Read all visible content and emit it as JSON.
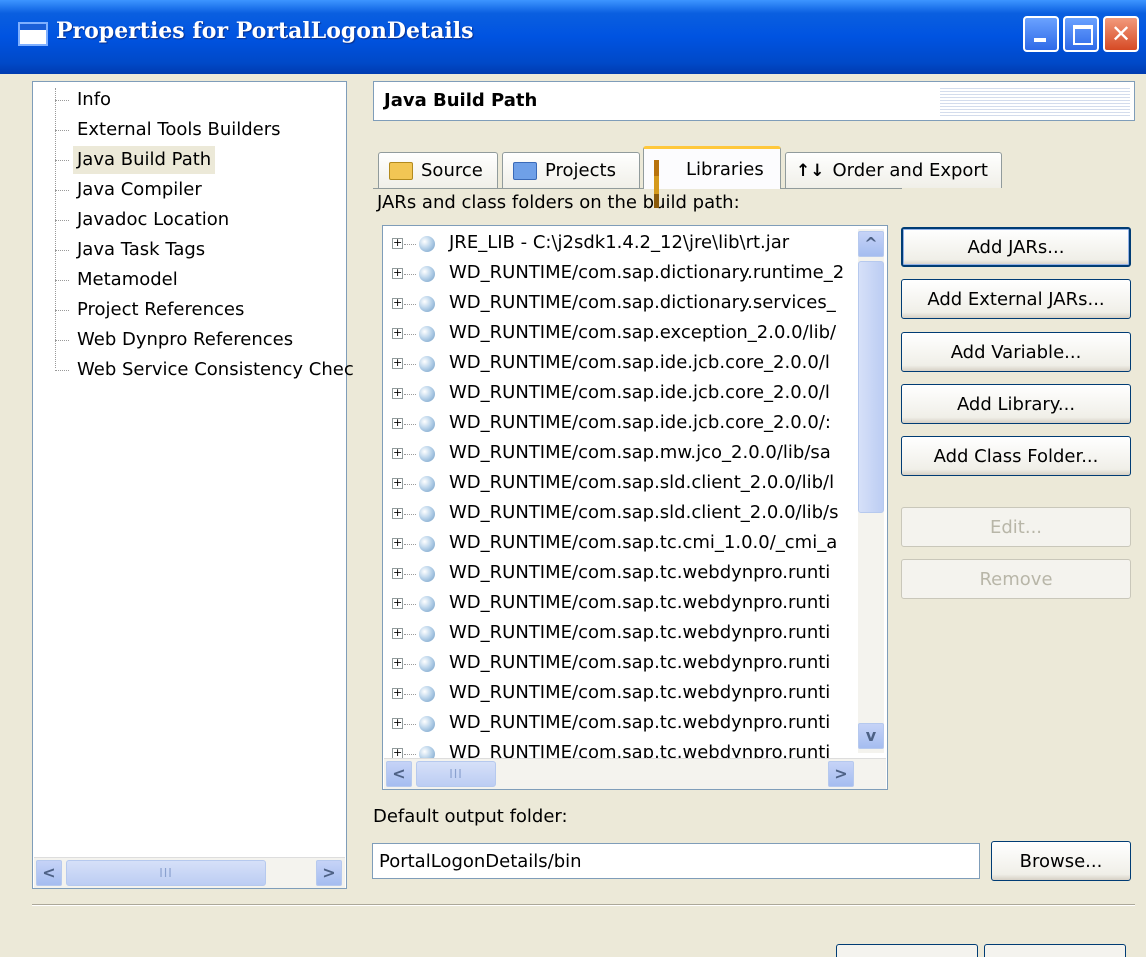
{
  "window": {
    "title": "Properties for PortalLogonDetails",
    "controls": [
      "minimize-icon",
      "maximize-icon",
      "close-icon"
    ],
    "close_glyph": "✕"
  },
  "tree": {
    "items": [
      {
        "label": "Info"
      },
      {
        "label": "External Tools Builders"
      },
      {
        "label": "Java Build Path",
        "selected": true
      },
      {
        "label": "Java Compiler"
      },
      {
        "label": "Javadoc Location"
      },
      {
        "label": "Java Task Tags"
      },
      {
        "label": "Metamodel"
      },
      {
        "label": "Project References"
      },
      {
        "label": "Web Dynpro References"
      },
      {
        "label": "Web Service Consistency Chec"
      }
    ],
    "scroll_left": "<",
    "scroll_right": ">",
    "thumb_grip": "III"
  },
  "header": {
    "title": "Java Build Path"
  },
  "tabs": [
    {
      "label": "Source",
      "icon": "source-folder-icon"
    },
    {
      "label": "Projects",
      "icon": "projects-folder-icon"
    },
    {
      "label": "Libraries",
      "icon": "libraries-icon",
      "active": true
    },
    {
      "label": "Order and Export",
      "icon": "order-arrows-icon",
      "glyph": "↑↓"
    }
  ],
  "libraries": {
    "caption": "JARs and class folders on the build path:",
    "entries": [
      "JRE_LIB - C:\\j2sdk1.4.2_12\\jre\\lib\\rt.jar",
      "WD_RUNTIME/com.sap.dictionary.runtime_2",
      "WD_RUNTIME/com.sap.dictionary.services_",
      "WD_RUNTIME/com.sap.exception_2.0.0/lib/",
      "WD_RUNTIME/com.sap.ide.jcb.core_2.0.0/l",
      "WD_RUNTIME/com.sap.ide.jcb.core_2.0.0/l",
      "WD_RUNTIME/com.sap.ide.jcb.core_2.0.0/:",
      "WD_RUNTIME/com.sap.mw.jco_2.0.0/lib/sa",
      "WD_RUNTIME/com.sap.sld.client_2.0.0/lib/l",
      "WD_RUNTIME/com.sap.sld.client_2.0.0/lib/s",
      "WD_RUNTIME/com.sap.tc.cmi_1.0.0/_cmi_a",
      "WD_RUNTIME/com.sap.tc.webdynpro.runti",
      "WD_RUNTIME/com.sap.tc.webdynpro.runti",
      "WD_RUNTIME/com.sap.tc.webdynpro.runti",
      "WD_RUNTIME/com.sap.tc.webdynpro.runti",
      "WD_RUNTIME/com.sap.tc.webdynpro.runti",
      "WD_RUNTIME/com.sap.tc.webdynpro.runti",
      "WD_RUNTIME/com.sap.tc.webdynpro.runti"
    ],
    "expander": "+",
    "scroll_up": "^",
    "scroll_down": "v",
    "scroll_left": "<",
    "scroll_right": ">",
    "thumb_grip": "III"
  },
  "buttons": {
    "add_jars": "Add JARs...",
    "add_external_jars": "Add External JARs...",
    "add_variable": "Add Variable...",
    "add_library": "Add Library...",
    "add_class_folder": "Add Class Folder...",
    "edit": "Edit...",
    "remove": "Remove",
    "browse": "Browse..."
  },
  "output": {
    "label": "Default output folder:",
    "value": "PortalLogonDetails/bin"
  }
}
